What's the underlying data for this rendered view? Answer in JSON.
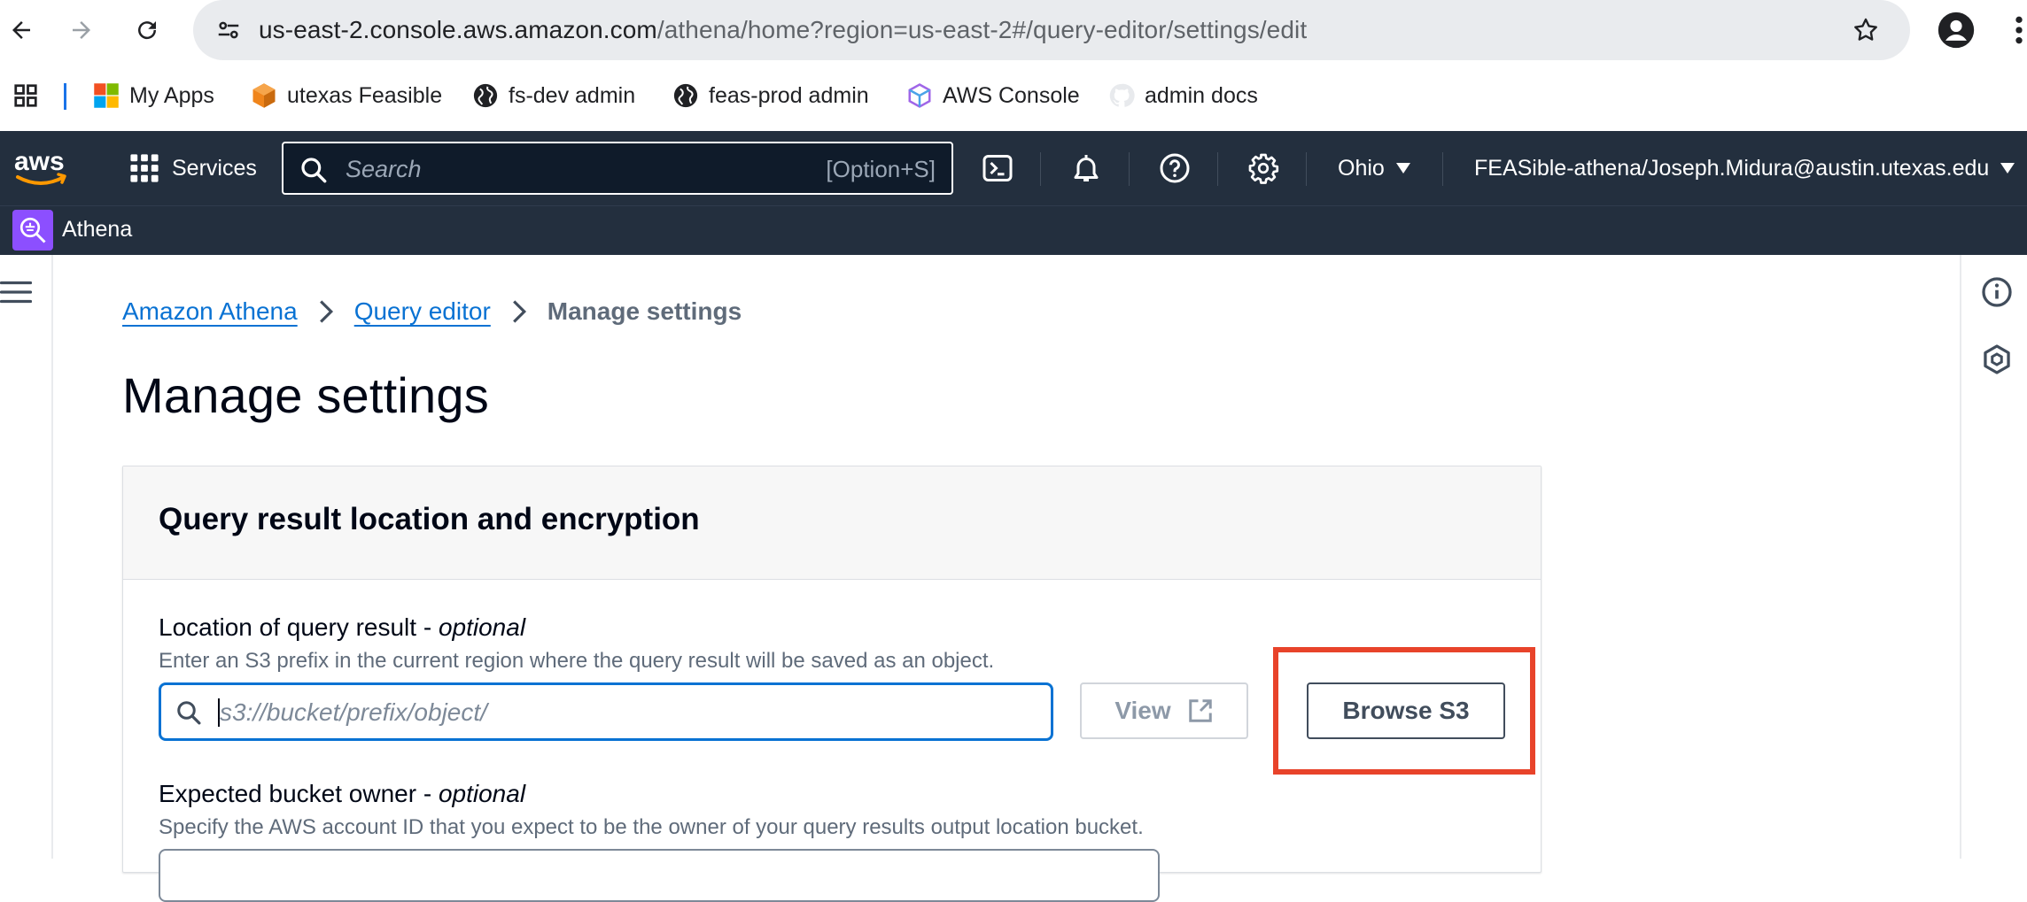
{
  "browser": {
    "url_host": "us-east-2.console.aws.amazon.com",
    "url_path": "/athena/home?region=us-east-2#/query-editor/settings/edit",
    "bookmarks": [
      {
        "label": "My Apps",
        "icon": "microsoft-icon"
      },
      {
        "label": "utexas Feasible",
        "icon": "package-icon"
      },
      {
        "label": "fs-dev admin",
        "icon": "globe-icon"
      },
      {
        "label": "feas-prod admin",
        "icon": "globe-icon"
      },
      {
        "label": "AWS Console",
        "icon": "cube-icon"
      },
      {
        "label": "admin docs",
        "icon": "github-icon"
      }
    ]
  },
  "aws_nav": {
    "services_label": "Services",
    "search_placeholder": "Search",
    "search_shortcut": "[Option+S]",
    "region": "Ohio",
    "account": "FEASible-athena/Joseph.Midura@austin.utexas.edu",
    "service_name": "Athena"
  },
  "breadcrumb": {
    "items": [
      "Amazon Athena",
      "Query editor"
    ],
    "current": "Manage settings"
  },
  "page": {
    "title": "Manage settings"
  },
  "panel": {
    "title": "Query result location and encryption",
    "location": {
      "label": "Location of query result - ",
      "label_optional": "optional",
      "description": "Enter an S3 prefix in the current region where the query result will be saved as an object.",
      "placeholder": "s3://bucket/prefix/object/",
      "view_label": "View",
      "browse_label": "Browse S3"
    },
    "owner": {
      "label": "Expected bucket owner - ",
      "label_optional": "optional",
      "description": "Specify the AWS account ID that you expect to be the owner of your query results output location bucket."
    }
  },
  "colors": {
    "aws_nav_bg": "#232f3e",
    "link": "#0972d3",
    "highlight": "#e8432a",
    "athena_badge": "#8c4fff"
  }
}
